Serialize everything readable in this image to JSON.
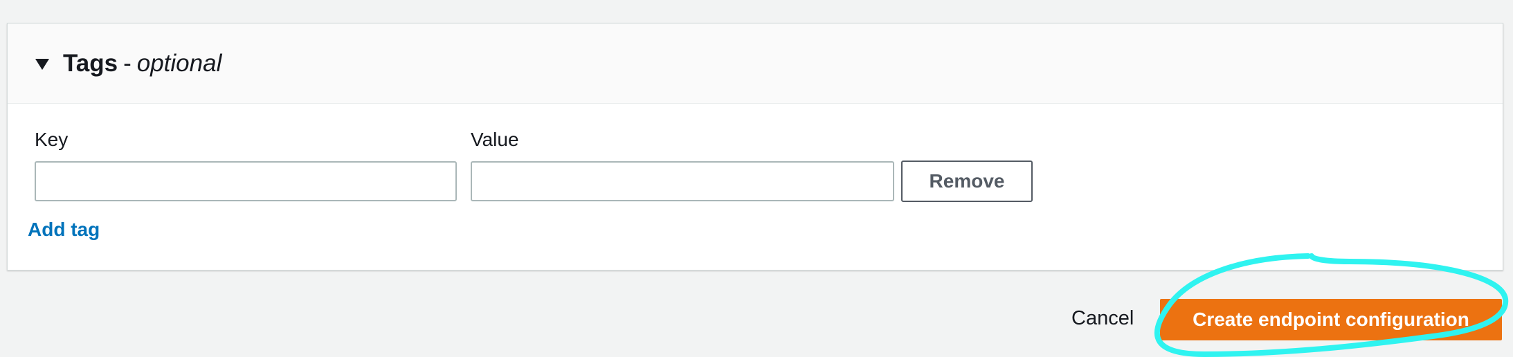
{
  "tags_section": {
    "title": "Tags",
    "separator": "-",
    "optional": "optional",
    "key_label": "Key",
    "key_value": "",
    "value_label": "Value",
    "value_value": "",
    "remove_label": "Remove",
    "add_tag_label": "Add tag"
  },
  "footer": {
    "cancel_label": "Cancel",
    "create_label": "Create endpoint configuration"
  },
  "colors": {
    "primary_button": "#ec7211",
    "link": "#0073bb",
    "annotation": "#2ff3f0",
    "background": "#f2f3f3"
  },
  "icons": {
    "expand": "caret-down-icon"
  }
}
